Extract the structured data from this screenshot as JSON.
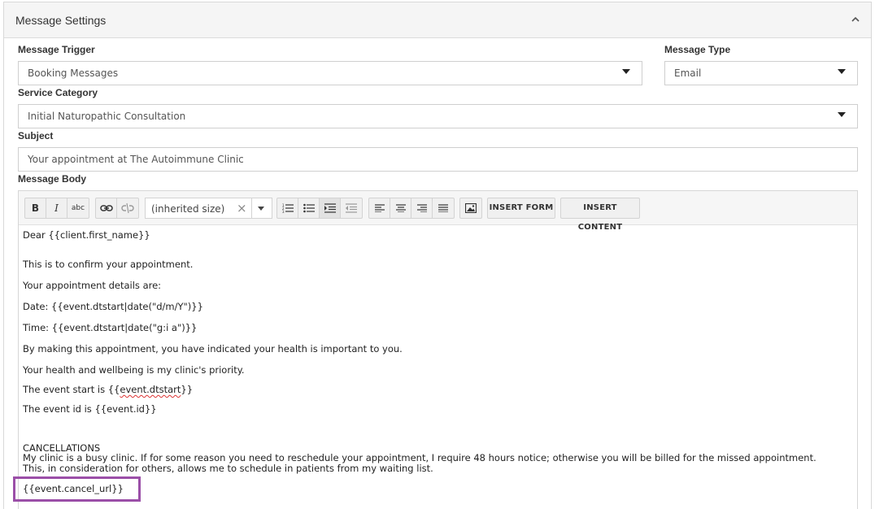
{
  "panel": {
    "title": "Message Settings",
    "collapse_icon": "chevron-up-icon"
  },
  "trigger": {
    "label": "Message Trigger",
    "value": "Booking Messages"
  },
  "type": {
    "label": "Message Type",
    "value": "Email"
  },
  "category": {
    "label": "Service Category",
    "value": "Initial Naturopathic Consultation"
  },
  "subject": {
    "label": "Subject",
    "value": "Your appointment at The Autoimmune Clinic"
  },
  "body_label": "Message Body",
  "toolbar": {
    "bold": "B",
    "italic": "I",
    "strike": "abc",
    "font_size": "(inherited size)",
    "clear": "×",
    "insert_form": "INSERT FORM",
    "insert_content": "INSERT CONTENT"
  },
  "body": {
    "greeting": "Dear {{client.first_name}}",
    "line1": "This is to confirm your appointment.",
    "line2": "Your appointment details are:",
    "date_line": "Date: {{event.dtstart|date(\"d/m/Y\")}}",
    "time_line": "Time: {{event.dtstart|date(\"g:i a\")}}",
    "line3": "By making this appointment, you have indicated your health is important to you.",
    "line4": "Your health and wellbeing is my clinic's priority.",
    "start_prefix": "The event start is {{",
    "start_var": "event.dtstart",
    "start_suffix": "}}",
    "id_line": "The event id is {{event.id}}",
    "cancel_heading": "CANCELLATIONS",
    "cancel_text": "My clinic is a busy clinic. If for some reason you need to reschedule your appointment, I require 48 hours notice; otherwise you will be billed for the missed appointment. This, in consideration for others, allows me to schedule in patients from my waiting list.",
    "cancel_url": "{{event.cancel_url}}"
  },
  "colors": {
    "highlight": "#9b4fa8"
  }
}
